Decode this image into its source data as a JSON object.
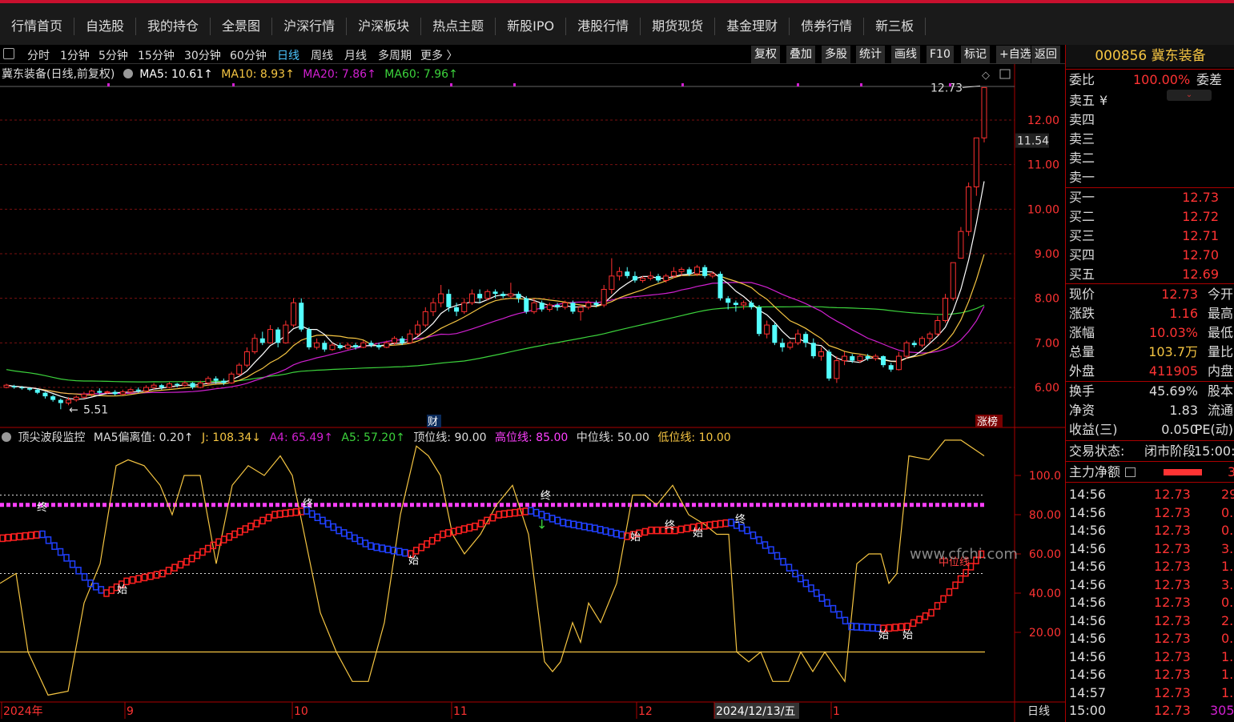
{
  "nav": [
    "行情首页",
    "自选股",
    "我的持仓",
    "全景图",
    "沪深行情",
    "沪深板块",
    "热点主题",
    "新股IPO",
    "港股行情",
    "期货现货",
    "基金理财",
    "债券行情",
    "新三板"
  ],
  "periods": [
    "分时",
    "1分钟",
    "5分钟",
    "15分钟",
    "30分钟",
    "60分钟",
    "日线",
    "周线",
    "月线",
    "多周期",
    "更多 〉"
  ],
  "active_period": "日线",
  "tools": [
    "复权",
    "叠加",
    "多股",
    "统计",
    "画线",
    "F10",
    "标记",
    "+自选",
    "返回"
  ],
  "main_legend": {
    "name": "冀东装备(日线,前复权)",
    "ma5": "MA5: 10.61↑",
    "ma10": "MA10: 8.93↑",
    "ma20": "MA20: 7.86↑",
    "ma60": "MA60: 7.96↑"
  },
  "ind_legend": {
    "name": "顶尖波段监控",
    "bias": "MA5偏离值: 0.20↑",
    "j": "J: 108.34↓",
    "a4": "A4: 65.49↑",
    "a5": "A5: 57.20↑",
    "top": "顶位线: 90.00",
    "high": "高位线: 85.00",
    "mid": "中位线: 50.00",
    "low": "低位线: 10.00"
  },
  "price_axis": [
    "12.00",
    "11.00",
    "10.00",
    "9.00",
    "8.00",
    "7.00",
    "6.00"
  ],
  "ind_axis": [
    "100.0",
    "80.00",
    "60.00",
    "40.00",
    "20.00"
  ],
  "current_price_tag": "11.54",
  "max_label": "12.73",
  "min_label": "5.51",
  "markers": {
    "cai": "财",
    "zhangbang": "涨榜",
    "zhong": "中位线",
    "watermark": "www.cfchi.com"
  },
  "date_axis": [
    "2024年",
    "9",
    "10",
    "11",
    "12",
    "2024/12/13/五",
    "1"
  ],
  "period_label": "日线",
  "signals": [
    "终",
    "始",
    "终",
    "始",
    "终",
    "始",
    "终",
    "始",
    "终",
    "始",
    "始终",
    "始"
  ],
  "stock": {
    "code": "000856",
    "name": "冀东装备"
  },
  "orderbook": {
    "weibi_label": "委比",
    "weibi_val": "100.00%",
    "weicha_label": "委差",
    "sell": [
      {
        "l": "卖五",
        "p": "¥"
      },
      {
        "l": "卖四",
        "p": ""
      },
      {
        "l": "卖三",
        "p": ""
      },
      {
        "l": "卖二",
        "p": ""
      },
      {
        "l": "卖一",
        "p": ""
      }
    ],
    "buy": [
      {
        "l": "买一",
        "p": "12.73"
      },
      {
        "l": "买二",
        "p": "12.72"
      },
      {
        "l": "买三",
        "p": "12.71"
      },
      {
        "l": "买四",
        "p": "12.70"
      },
      {
        "l": "买五",
        "p": "12.69"
      }
    ]
  },
  "stats": [
    {
      "l": "现价",
      "v": "12.73",
      "r": "今开"
    },
    {
      "l": "涨跌",
      "v": "1.16",
      "r": "最高"
    },
    {
      "l": "涨幅",
      "v": "10.03%",
      "r": "最低"
    },
    {
      "l": "总量",
      "v": "103.7万",
      "r": "量比"
    },
    {
      "l": "外盘",
      "v": "411905",
      "r": "内盘"
    }
  ],
  "stats2": [
    {
      "l": "换手",
      "v": "45.69%",
      "r": "股本"
    },
    {
      "l": "净资",
      "v": "1.83",
      "r": "流通"
    },
    {
      "l": "收益(三)",
      "v": "0.050",
      "r": "PE(动)"
    }
  ],
  "trade_status_label": "交易状态:",
  "trade_status": "闭市阶段",
  "trade_time": "15:00:",
  "main_flow_label": "主力净额",
  "main_flow_val": "3",
  "ticks": [
    {
      "t": "14:56",
      "p": "12.73",
      "v": "29."
    },
    {
      "t": "14:56",
      "p": "12.73",
      "v": "0."
    },
    {
      "t": "14:56",
      "p": "12.73",
      "v": "0."
    },
    {
      "t": "14:56",
      "p": "12.73",
      "v": "3."
    },
    {
      "t": "14:56",
      "p": "12.73",
      "v": "1."
    },
    {
      "t": "14:56",
      "p": "12.73",
      "v": "3."
    },
    {
      "t": "14:56",
      "p": "12.73",
      "v": "0."
    },
    {
      "t": "14:56",
      "p": "12.73",
      "v": "2."
    },
    {
      "t": "14:56",
      "p": "12.73",
      "v": "0."
    },
    {
      "t": "14:56",
      "p": "12.73",
      "v": "1."
    },
    {
      "t": "14:56",
      "p": "12.73",
      "v": "1."
    },
    {
      "t": "14:57",
      "p": "12.73",
      "v": "1."
    },
    {
      "t": "15:00",
      "p": "12.73",
      "v": "305."
    }
  ],
  "chart_data": {
    "type": "candlestick",
    "y_range": [
      5.4,
      12.8
    ],
    "candles": [
      [
        6.0,
        6.05,
        6.08,
        5.98
      ],
      [
        6.03,
        6.0,
        6.06,
        5.97
      ],
      [
        6.0,
        5.98,
        6.03,
        5.95
      ],
      [
        5.98,
        5.95,
        6.0,
        5.92
      ],
      [
        5.95,
        5.88,
        5.97,
        5.85
      ],
      [
        5.88,
        5.8,
        5.9,
        5.75
      ],
      [
        5.8,
        5.72,
        5.83,
        5.68
      ],
      [
        5.72,
        5.65,
        5.75,
        5.51
      ],
      [
        5.65,
        5.72,
        5.78,
        5.6
      ],
      [
        5.72,
        5.78,
        5.82,
        5.68
      ],
      [
        5.78,
        5.85,
        5.9,
        5.75
      ],
      [
        5.85,
        5.92,
        5.95,
        5.8
      ],
      [
        5.92,
        5.88,
        5.98,
        5.85
      ],
      [
        5.88,
        5.9,
        5.93,
        5.85
      ],
      [
        5.9,
        5.85,
        5.94,
        5.82
      ],
      [
        5.85,
        5.9,
        5.95,
        5.83
      ],
      [
        5.9,
        5.95,
        5.98,
        5.86
      ],
      [
        5.95,
        5.92,
        6.0,
        5.88
      ],
      [
        5.92,
        6.0,
        6.05,
        5.9
      ],
      [
        6.0,
        6.05,
        6.1,
        5.96
      ],
      [
        6.05,
        6.0,
        6.08,
        5.95
      ],
      [
        6.0,
        6.08,
        6.12,
        5.98
      ],
      [
        6.08,
        6.05,
        6.1,
        6.0
      ],
      [
        6.05,
        6.1,
        6.15,
        6.02
      ],
      [
        6.1,
        6.0,
        6.12,
        5.96
      ],
      [
        6.0,
        6.1,
        6.15,
        5.98
      ],
      [
        6.1,
        6.2,
        6.25,
        6.05
      ],
      [
        6.2,
        6.15,
        6.25,
        6.08
      ],
      [
        6.15,
        6.1,
        6.2,
        6.05
      ],
      [
        6.1,
        6.3,
        6.35,
        6.08
      ],
      [
        6.3,
        6.5,
        6.55,
        6.25
      ],
      [
        6.5,
        6.8,
        6.9,
        6.45
      ],
      [
        6.8,
        7.1,
        7.2,
        6.75
      ],
      [
        7.1,
        7.0,
        7.25,
        6.95
      ],
      [
        7.0,
        7.3,
        7.4,
        6.98
      ],
      [
        7.3,
        7.0,
        7.35,
        6.9
      ],
      [
        7.0,
        7.4,
        7.5,
        6.98
      ],
      [
        7.4,
        7.9,
        8.0,
        7.35
      ],
      [
        7.9,
        7.3,
        8.0,
        7.25
      ],
      [
        7.3,
        6.9,
        7.35,
        6.85
      ],
      [
        6.9,
        7.0,
        7.1,
        6.85
      ],
      [
        7.0,
        6.85,
        7.05,
        6.8
      ],
      [
        6.85,
        6.95,
        7.0,
        6.82
      ],
      [
        6.95,
        6.88,
        7.0,
        6.85
      ],
      [
        6.88,
        6.95,
        7.0,
        6.85
      ],
      [
        6.95,
        6.9,
        7.0,
        6.85
      ],
      [
        6.9,
        7.0,
        7.05,
        6.88
      ],
      [
        7.0,
        6.95,
        7.05,
        6.9
      ],
      [
        6.95,
        6.9,
        7.0,
        6.85
      ],
      [
        6.9,
        7.0,
        7.05,
        6.88
      ],
      [
        7.0,
        7.1,
        7.15,
        6.95
      ],
      [
        7.1,
        7.0,
        7.15,
        6.95
      ],
      [
        7.0,
        7.2,
        7.3,
        6.98
      ],
      [
        7.2,
        7.4,
        7.5,
        7.15
      ],
      [
        7.4,
        7.7,
        7.8,
        7.35
      ],
      [
        7.7,
        7.9,
        8.0,
        7.6
      ],
      [
        7.9,
        8.1,
        8.3,
        7.8
      ],
      [
        8.1,
        7.8,
        8.2,
        7.7
      ],
      [
        7.8,
        7.7,
        7.9,
        7.6
      ],
      [
        7.7,
        7.9,
        8.0,
        7.65
      ],
      [
        7.9,
        8.1,
        8.2,
        7.85
      ],
      [
        8.1,
        8.0,
        8.2,
        7.9
      ],
      [
        8.0,
        8.15,
        8.2,
        7.95
      ],
      [
        8.15,
        8.1,
        8.2,
        8.0
      ],
      [
        8.1,
        8.05,
        8.15,
        8.0
      ],
      [
        8.05,
        8.1,
        8.35,
        8.0
      ],
      [
        8.1,
        8.0,
        8.15,
        7.9
      ],
      [
        8.0,
        7.7,
        8.05,
        7.65
      ],
      [
        7.7,
        7.9,
        8.0,
        7.65
      ],
      [
        7.9,
        7.75,
        7.95,
        7.7
      ],
      [
        7.75,
        7.85,
        7.9,
        7.7
      ],
      [
        7.85,
        7.8,
        7.9,
        7.72
      ],
      [
        7.8,
        7.9,
        7.95,
        7.75
      ],
      [
        7.9,
        7.7,
        7.95,
        7.65
      ],
      [
        7.7,
        7.8,
        7.85,
        7.5
      ],
      [
        7.8,
        7.9,
        7.95,
        7.75
      ],
      [
        7.9,
        7.85,
        7.95,
        7.8
      ],
      [
        7.85,
        8.2,
        8.3,
        7.8
      ],
      [
        8.2,
        8.5,
        8.9,
        8.1
      ],
      [
        8.5,
        8.6,
        8.7,
        8.4
      ],
      [
        8.6,
        8.5,
        8.7,
        8.45
      ],
      [
        8.5,
        8.4,
        8.6,
        8.35
      ],
      [
        8.4,
        8.45,
        8.5,
        8.35
      ],
      [
        8.45,
        8.5,
        8.6,
        8.4
      ],
      [
        8.5,
        8.4,
        8.55,
        8.35
      ],
      [
        8.4,
        8.5,
        8.55,
        8.35
      ],
      [
        8.5,
        8.6,
        8.7,
        8.45
      ],
      [
        8.6,
        8.65,
        8.7,
        8.5
      ],
      [
        8.65,
        8.55,
        8.7,
        8.5
      ],
      [
        8.55,
        8.7,
        8.75,
        8.5
      ],
      [
        8.7,
        8.5,
        8.75,
        8.45
      ],
      [
        8.5,
        8.55,
        8.6,
        8.45
      ],
      [
        8.55,
        8.0,
        8.6,
        7.95
      ],
      [
        8.0,
        7.9,
        8.05,
        7.75
      ],
      [
        7.9,
        7.85,
        7.95,
        7.7
      ],
      [
        7.85,
        7.9,
        7.95,
        7.75
      ],
      [
        7.9,
        7.8,
        7.95,
        7.75
      ],
      [
        7.8,
        7.2,
        7.85,
        7.15
      ],
      [
        7.2,
        7.4,
        7.5,
        7.1
      ],
      [
        7.4,
        7.0,
        7.45,
        6.95
      ],
      [
        7.0,
        6.9,
        7.1,
        6.8
      ],
      [
        6.9,
        7.0,
        7.05,
        6.85
      ],
      [
        7.0,
        7.2,
        7.3,
        6.95
      ],
      [
        7.2,
        7.0,
        7.25,
        6.9
      ],
      [
        7.0,
        6.7,
        7.1,
        6.65
      ],
      [
        6.7,
        6.8,
        6.9,
        6.6
      ],
      [
        6.8,
        6.2,
        6.85,
        6.15
      ],
      [
        6.2,
        6.6,
        6.7,
        6.1
      ],
      [
        6.6,
        6.7,
        6.8,
        6.5
      ],
      [
        6.7,
        6.6,
        6.75,
        6.55
      ],
      [
        6.6,
        6.7,
        6.75,
        6.55
      ],
      [
        6.7,
        6.65,
        6.75,
        6.6
      ],
      [
        6.65,
        6.7,
        6.75,
        6.6
      ],
      [
        6.7,
        6.5,
        6.72,
        6.45
      ],
      [
        6.5,
        6.4,
        6.55,
        6.35
      ],
      [
        6.4,
        6.7,
        6.8,
        6.38
      ],
      [
        6.7,
        7.0,
        7.05,
        6.65
      ],
      [
        7.0,
        6.95,
        7.05,
        6.9
      ],
      [
        6.95,
        7.1,
        7.15,
        6.9
      ],
      [
        7.1,
        7.2,
        7.25,
        7.0
      ],
      [
        7.2,
        7.5,
        7.6,
        7.15
      ],
      [
        7.5,
        8.0,
        8.1,
        7.45
      ],
      [
        8.0,
        8.8,
        8.8,
        7.95
      ],
      [
        8.9,
        9.5,
        9.6,
        9.1
      ],
      [
        9.5,
        10.5,
        10.6,
        9.4
      ],
      [
        10.5,
        11.6,
        11.6,
        10.3
      ],
      [
        11.6,
        12.73,
        12.73,
        11.5
      ]
    ],
    "ma_series": [
      "MA5",
      "MA10",
      "MA20",
      "MA60"
    ]
  }
}
